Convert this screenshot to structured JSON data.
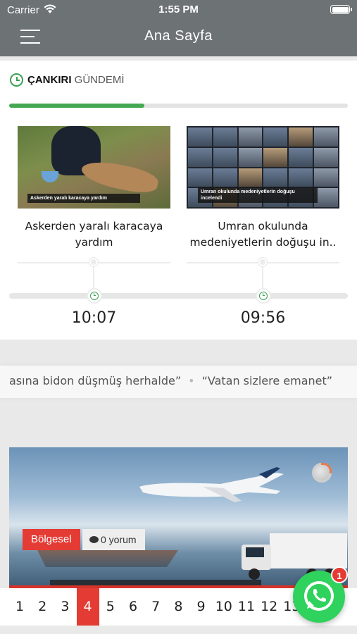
{
  "status_bar": {
    "carrier": "Carrier",
    "time": "1:55 PM"
  },
  "nav": {
    "title": "Ana Sayfa",
    "menu_icon": "hamburger-icon"
  },
  "gundem": {
    "title_bold": "ÇANKIRI",
    "title_light": "GÜNDEMİ",
    "accent_color": "#44a852",
    "progress_fraction": 0.4,
    "items": [
      {
        "thumb_caption": "Askerden yaralı karacaya yardım",
        "title": "Askerden yaralı karacaya yardım",
        "time": "10:07"
      },
      {
        "thumb_caption": "Umran okulunda medeniyetlerin doğuşu incelendi",
        "title": "Umran okulunda medeniyetlerin doğuşu in..",
        "time": "09:56"
      }
    ]
  },
  "ticker": {
    "text_left": "asına bidon düşmüş herhalde”",
    "separator": "•",
    "text_right": "“Vatan sizlere emanet”"
  },
  "featured": {
    "category": "Bölgesel",
    "comments": "0 yorum",
    "category_color": "#e43b34"
  },
  "pager": {
    "pages": [
      "1",
      "2",
      "3",
      "4",
      "5",
      "6",
      "7",
      "8",
      "9",
      "10",
      "11",
      "12",
      "13"
    ],
    "active_page": "4",
    "partial_trailing": "5"
  },
  "whatsapp": {
    "icon": "whatsapp-icon",
    "badge_count": "1",
    "color": "#2fd25c"
  }
}
